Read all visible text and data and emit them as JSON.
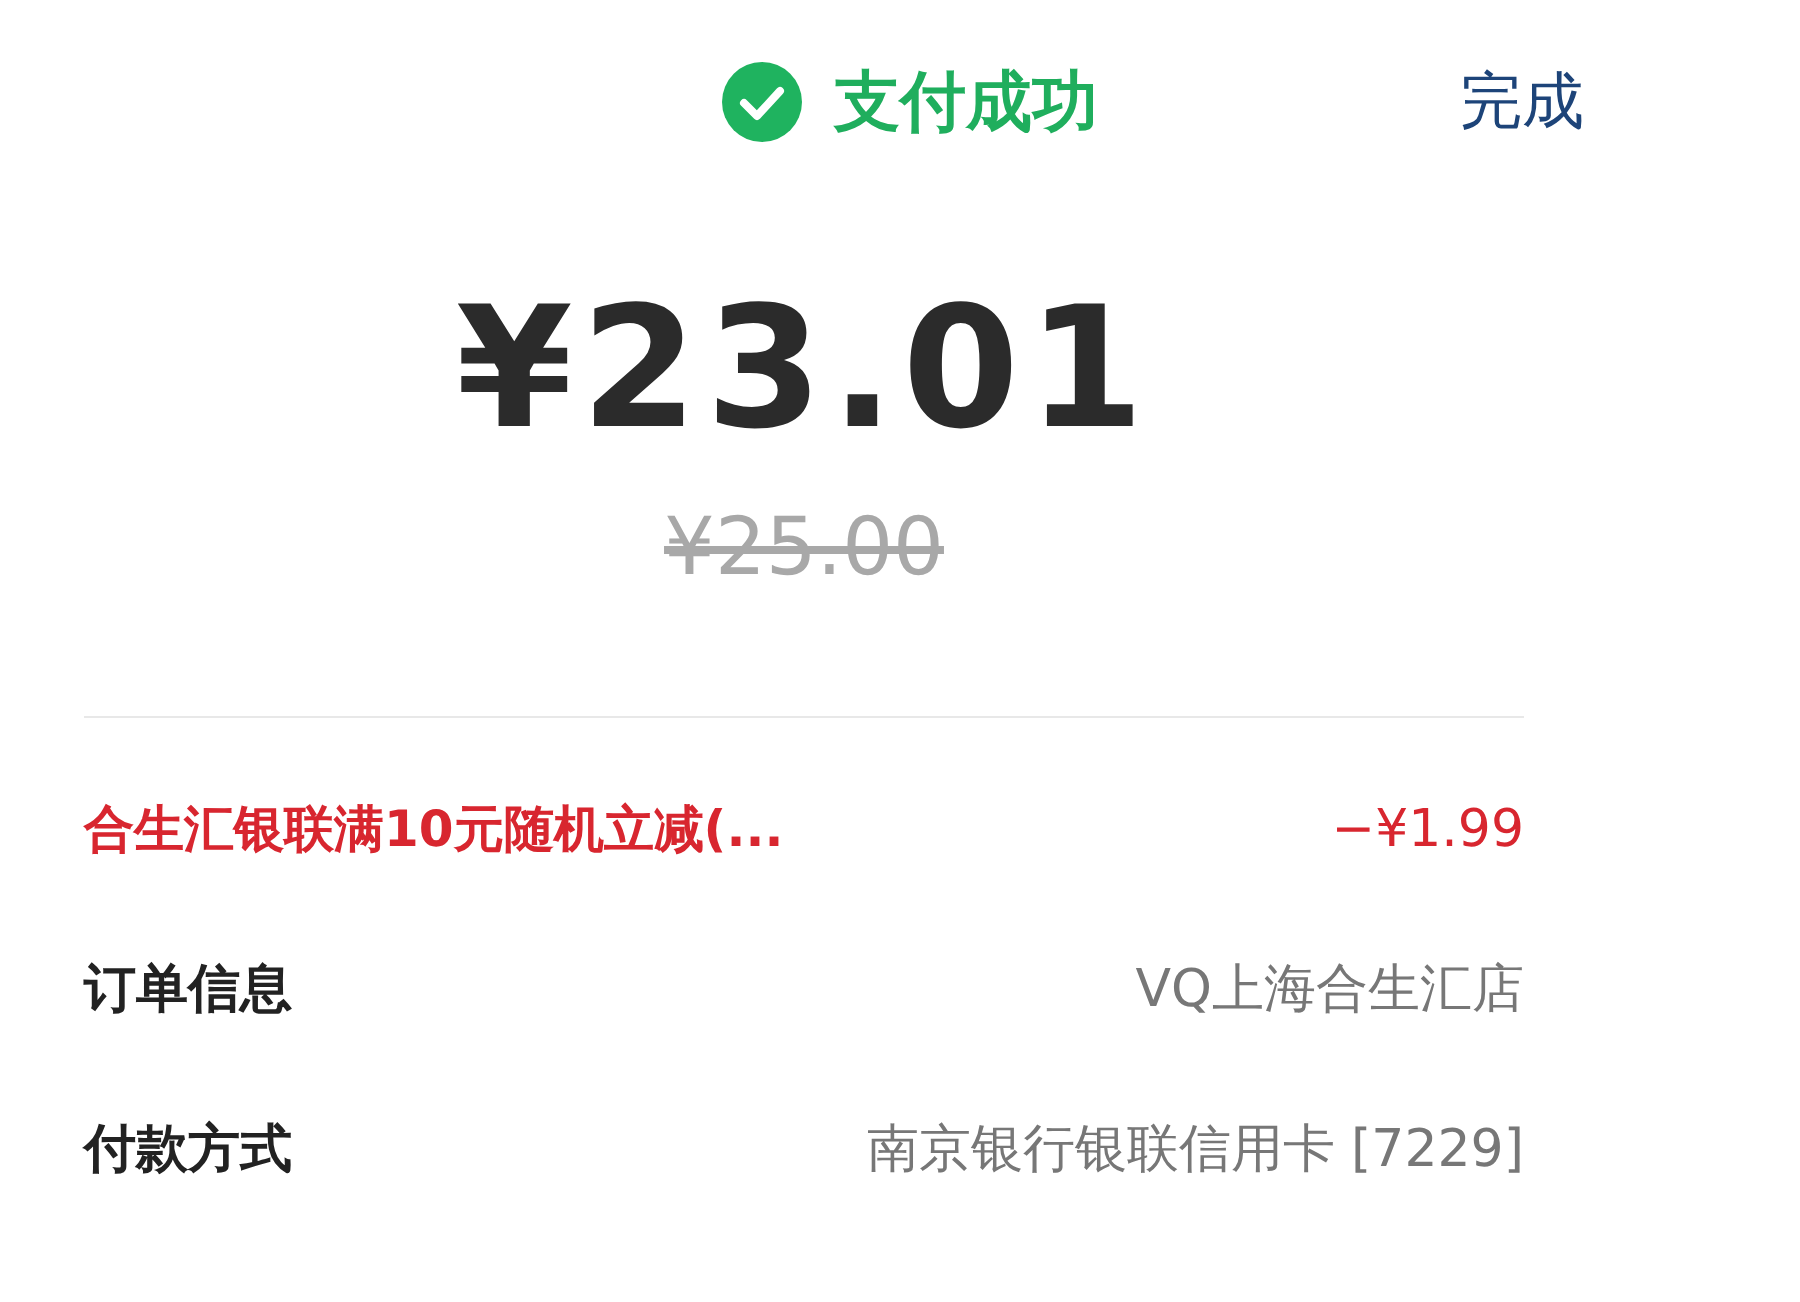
{
  "header": {
    "status": "支付成功",
    "done_button": "完成"
  },
  "amount": "¥23.01",
  "original_amount": "¥25.00",
  "discount": {
    "label": "合生汇银联满10元随机立减(...",
    "value": "−¥1.99"
  },
  "details": [
    {
      "label": "订单信息",
      "value": "VQ上海合生汇店"
    },
    {
      "label": "付款方式",
      "value": "南京银行银联信用卡 [7229]"
    }
  ]
}
